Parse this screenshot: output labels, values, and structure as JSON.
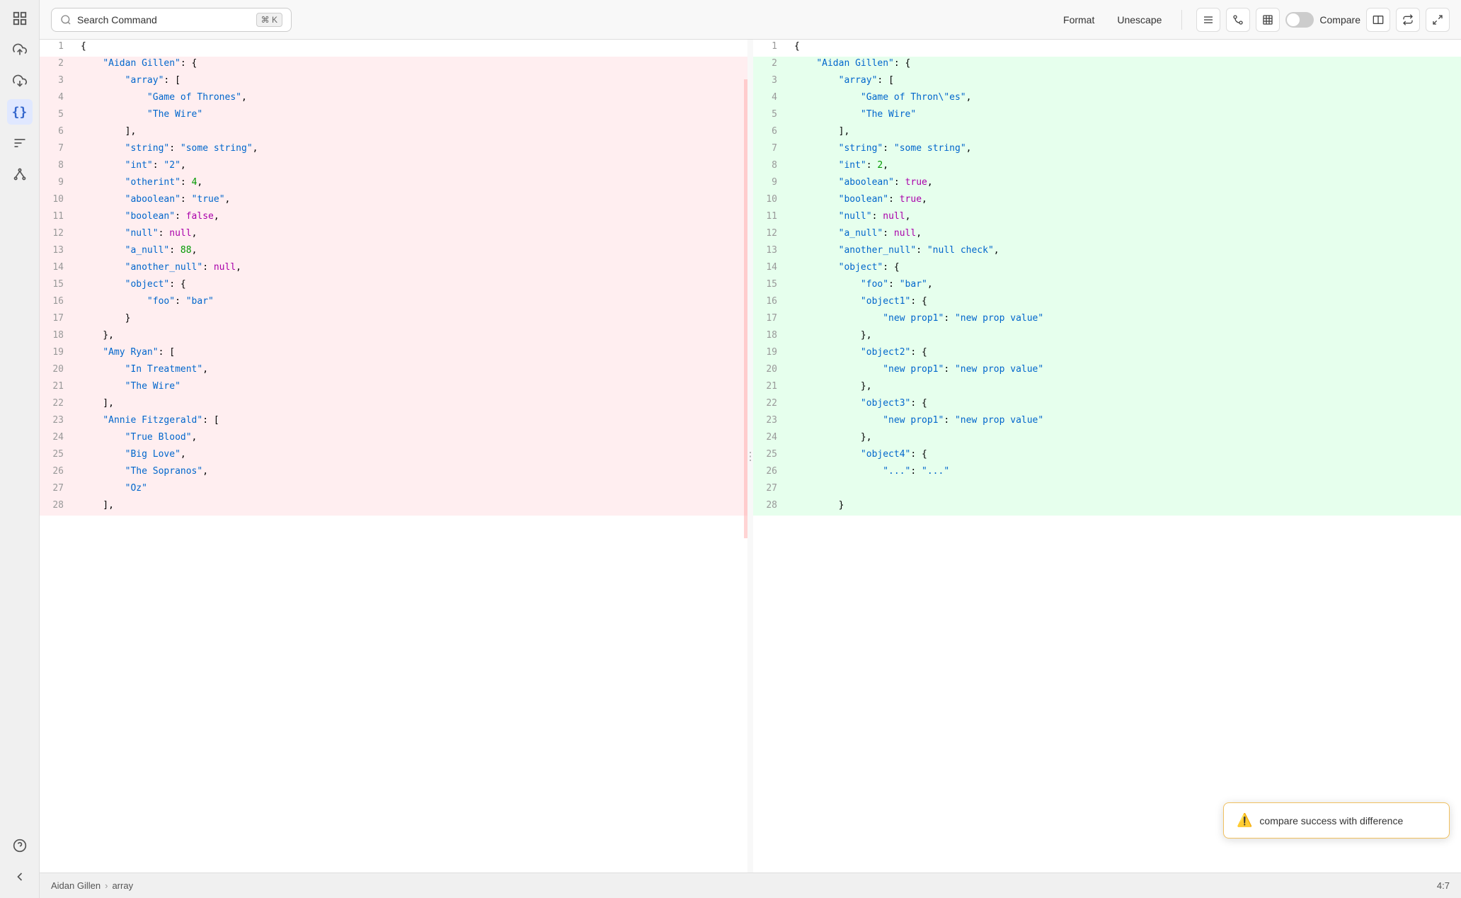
{
  "toolbar": {
    "search_placeholder": "Search Command",
    "shortcut": "⌘ K",
    "format_label": "Format",
    "unescape_label": "Unescape",
    "compare_label": "Compare",
    "toggle_state": false
  },
  "icons": {
    "menu": "☰",
    "branch": "⎇",
    "table": "⊞",
    "compare_split": "⧉",
    "swap": "⇄",
    "fullscreen": "⛶",
    "search": "🔍",
    "upload": "↑",
    "download": "↓",
    "braces": "{}",
    "sort": "↕",
    "network": "⎋",
    "warning": "⚠",
    "chevron_right": "›",
    "collapse": "‹"
  },
  "left_pane": {
    "lines": [
      {
        "num": 1,
        "text": "{",
        "type": "normal"
      },
      {
        "num": 2,
        "text": "    \"Aidan Gillen\": {",
        "type": "removed"
      },
      {
        "num": 3,
        "text": "        \"array\": [",
        "type": "removed"
      },
      {
        "num": 4,
        "text": "            \"Game of Thrones\",",
        "type": "removed",
        "highlight": true
      },
      {
        "num": 5,
        "text": "            \"The Wire\"",
        "type": "removed"
      },
      {
        "num": 6,
        "text": "        ],",
        "type": "removed"
      },
      {
        "num": 7,
        "text": "        \"string\": \"some string\",",
        "type": "removed"
      },
      {
        "num": 8,
        "text": "        \"int\": \"2\",",
        "type": "removed"
      },
      {
        "num": 9,
        "text": "        \"otherint\": 4,",
        "type": "removed"
      },
      {
        "num": 10,
        "text": "        \"aboolean\": \"true\",",
        "type": "removed"
      },
      {
        "num": 11,
        "text": "        \"boolean\": false,",
        "type": "removed"
      },
      {
        "num": 12,
        "text": "        \"null\": null,",
        "type": "removed"
      },
      {
        "num": 13,
        "text": "        \"a_null\": 88,",
        "type": "removed"
      },
      {
        "num": 14,
        "text": "        \"another_null\": null,",
        "type": "removed"
      },
      {
        "num": 15,
        "text": "        \"object\": {",
        "type": "removed"
      },
      {
        "num": 16,
        "text": "            \"foo\": \"bar\"",
        "type": "removed"
      },
      {
        "num": 17,
        "text": "        }",
        "type": "removed"
      },
      {
        "num": 18,
        "text": "    },",
        "type": "removed"
      },
      {
        "num": 19,
        "text": "    \"Amy Ryan\": [",
        "type": "removed"
      },
      {
        "num": 20,
        "text": "        \"In Treatment\",",
        "type": "removed"
      },
      {
        "num": 21,
        "text": "        \"The Wire\"",
        "type": "removed"
      },
      {
        "num": 22,
        "text": "    ],",
        "type": "removed"
      },
      {
        "num": 23,
        "text": "    \"Annie Fitzgerald\": [",
        "type": "removed"
      },
      {
        "num": 24,
        "text": "        \"True Blood\",",
        "type": "removed"
      },
      {
        "num": 25,
        "text": "        \"Big Love\",",
        "type": "removed"
      },
      {
        "num": 26,
        "text": "        \"The Sopranos\",",
        "type": "removed"
      },
      {
        "num": 27,
        "text": "        \"Oz\"",
        "type": "removed"
      },
      {
        "num": 28,
        "text": "    ],",
        "type": "removed"
      }
    ]
  },
  "right_pane": {
    "lines": [
      {
        "num": 1,
        "text": "{",
        "type": "normal"
      },
      {
        "num": 2,
        "text": "    \"Aidan Gillen\": {",
        "type": "added"
      },
      {
        "num": 3,
        "text": "        \"array\": [",
        "type": "added"
      },
      {
        "num": 4,
        "text": "            \"Game of Thron\\\"es\",",
        "type": "added",
        "highlight": true
      },
      {
        "num": 5,
        "text": "            \"The Wire\"",
        "type": "added"
      },
      {
        "num": 6,
        "text": "        ],",
        "type": "added"
      },
      {
        "num": 7,
        "text": "        \"string\": \"some string\",",
        "type": "added"
      },
      {
        "num": 8,
        "text": "        \"int\": 2,",
        "type": "added"
      },
      {
        "num": 9,
        "text": "        \"aboolean\": true,",
        "type": "added"
      },
      {
        "num": 10,
        "text": "        \"boolean\": true,",
        "type": "added"
      },
      {
        "num": 11,
        "text": "        \"null\": null,",
        "type": "added"
      },
      {
        "num": 12,
        "text": "        \"a_null\": null,",
        "type": "added"
      },
      {
        "num": 13,
        "text": "        \"another_null\": \"null check\",",
        "type": "added"
      },
      {
        "num": 14,
        "text": "        \"object\": {",
        "type": "added"
      },
      {
        "num": 15,
        "text": "            \"foo\": \"bar\",",
        "type": "added"
      },
      {
        "num": 16,
        "text": "            \"object1\": {",
        "type": "added"
      },
      {
        "num": 17,
        "text": "                \"new prop1\": \"new prop value\"",
        "type": "added"
      },
      {
        "num": 18,
        "text": "            },",
        "type": "added"
      },
      {
        "num": 19,
        "text": "            \"object2\": {",
        "type": "added"
      },
      {
        "num": 20,
        "text": "                \"new prop1\": \"new prop value\"",
        "type": "added"
      },
      {
        "num": 21,
        "text": "            },",
        "type": "added"
      },
      {
        "num": 22,
        "text": "            \"object3\": {",
        "type": "added"
      },
      {
        "num": 23,
        "text": "                \"new prop1\": \"new prop value\"",
        "type": "added"
      },
      {
        "num": 24,
        "text": "            },",
        "type": "added"
      },
      {
        "num": 25,
        "text": "            \"object4\": {",
        "type": "added"
      },
      {
        "num": 26,
        "text": "                \"...\": \"...\"",
        "type": "added"
      },
      {
        "num": 27,
        "text": "",
        "type": "added"
      },
      {
        "num": 28,
        "text": "        }",
        "type": "added"
      }
    ]
  },
  "status_bar": {
    "breadcrumb_item1": "Aidan Gillen",
    "breadcrumb_item2": "array",
    "position": "4:7"
  },
  "toast": {
    "message": "compare success with difference",
    "icon": "⚠"
  }
}
